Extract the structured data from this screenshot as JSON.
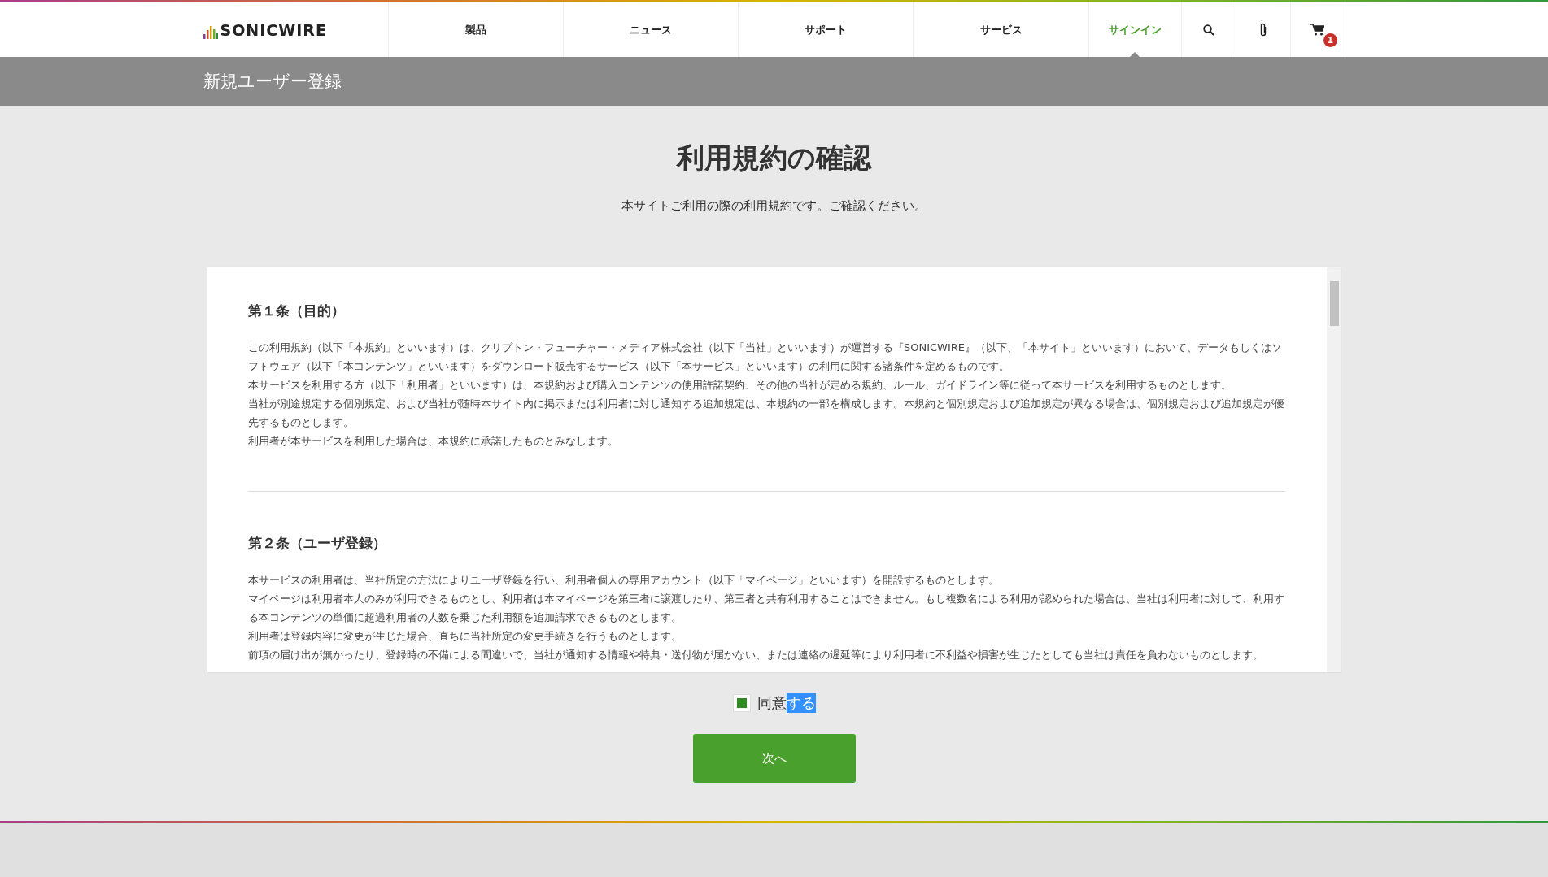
{
  "header": {
    "logo": "SONICWIRE",
    "nav": [
      {
        "label": "製品",
        "selected": false
      },
      {
        "label": "ニュース",
        "selected": false
      },
      {
        "label": "サポート",
        "selected": false
      },
      {
        "label": "サービス",
        "selected": false
      },
      {
        "label": "サインイン",
        "selected": true
      }
    ],
    "cart_count": "1"
  },
  "page_bar": {
    "title": "新規ユーザー登録"
  },
  "main": {
    "heading": "利用規約の確認",
    "lead": "本サイトご利用の際の利用規約です。ご確認ください。"
  },
  "terms": [
    {
      "title": "第１条（目的）",
      "paragraphs": [
        "この利用規約（以下「本規約」といいます）は、クリプトン・フューチャー・メディア株式会社（以下「当社」といいます）が運営する『SONICWIRE』（以下、「本サイト」といいます）において、データもしくはソフトウェア（以下「本コンテンツ」といいます）をダウンロード販売するサービス（以下「本サービス」といいます）の利用に関する諸条件を定めるものです。",
        "本サービスを利用する方（以下「利用者」といいます）は、本規約および購入コンテンツの使用許諾契約、その他の当社が定める規約、ルール、ガイドライン等に従って本サービスを利用するものとします。",
        "当社が別途規定する個別規定、および当社が随時本サイト内に掲示または利用者に対し通知する追加規定は、本規約の一部を構成します。本規約と個別規定および追加規定が異なる場合は、個別規定および追加規定が優先するものとします。",
        "利用者が本サービスを利用した場合は、本規約に承諾したものとみなします。"
      ]
    },
    {
      "title": "第２条（ユーザ登録）",
      "paragraphs": [
        "本サービスの利用者は、当社所定の方法によりユーザ登録を行い、利用者個人の専用アカウント（以下「マイページ」といいます）を開設するものとします。",
        "マイページは利用者本人のみが利用できるものとし、利用者は本マイページを第三者に譲渡したり、第三者と共有利用することはできません。もし複数名による利用が認められた場合は、当社は利用者に対して、利用する本コンテンツの単価に超過利用者の人数を乗じた利用額を追加請求できるものとします。",
        "利用者は登録内容に変更が生じた場合、直ちに当社所定の変更手続きを行うものとします。",
        "前項の届け出が無かったり、登録時の不備による間違いで、当社が通知する情報や特典・送付物が届かない、または連絡の遅延等により利用者に不利益や損害が生じたとしても当社は責任を負わないものとします。"
      ]
    }
  ],
  "agree": {
    "label": "同意",
    "highlighted": "する",
    "checked": true
  },
  "next_button": "次へ"
}
